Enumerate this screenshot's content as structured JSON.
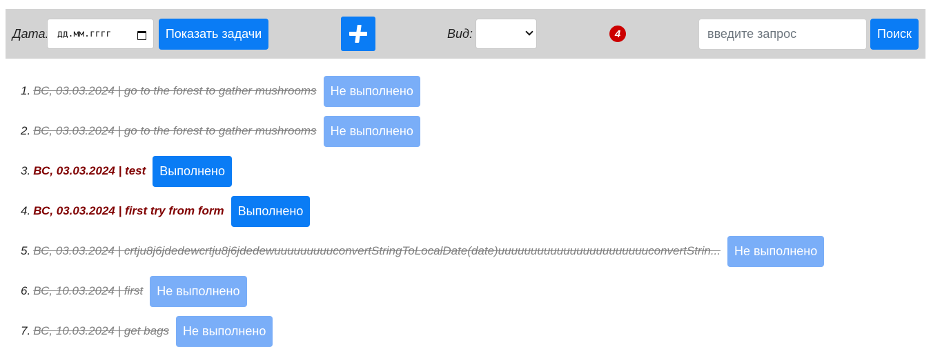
{
  "toolbar": {
    "date_label": "Дата:",
    "date_placeholder": "дд.мм.гггг",
    "show_tasks_label": "Показать задачи",
    "add_icon": "plus-icon",
    "view_label": "Вид:",
    "view_selected": "",
    "count_badge": "4",
    "search_placeholder": "введите запрос",
    "search_button_label": "Поиск",
    "colors": {
      "background": "#d3d3d3",
      "primary": "#0a7cf5",
      "badge": "#cc0000"
    }
  },
  "tasks": [
    {
      "number": "1.",
      "text": "ВС, 03.03.2024 | go to the forest to gather mushrooms",
      "status_label": "Не выполнено",
      "done": false
    },
    {
      "number": "2.",
      "text": "ВС, 03.03.2024 | go to the forest to gather mushrooms",
      "status_label": "Не выполнено",
      "done": false
    },
    {
      "number": "3.",
      "text": "ВС, 03.03.2024 | test",
      "status_label": "Выполнено",
      "done": true
    },
    {
      "number": "4.",
      "text": "ВС, 03.03.2024 | first try from form",
      "status_label": "Выполнено",
      "done": true
    },
    {
      "number": "5.",
      "text": "ВС, 03.03.2024 | crtju8j6jdedewcrtju8j6jdedewuuuuuuuuuconvertStringToLocalDate(date)uuuuuuuuuuuuuuuuuuuuuuuconvertStrin...",
      "status_label": "Не выполнено",
      "done": false
    },
    {
      "number": "6.",
      "text": "ВС, 10.03.2024 | first",
      "status_label": "Не выполнено",
      "done": false
    },
    {
      "number": "7.",
      "text": "ВС, 10.03.2024 | get bags",
      "status_label": "Не выполнено",
      "done": false
    }
  ],
  "status_colors": {
    "done_button": "#0a7cf5",
    "undone_button": "#7aaef8",
    "done_text": "#800000",
    "undone_text": "#808080"
  }
}
